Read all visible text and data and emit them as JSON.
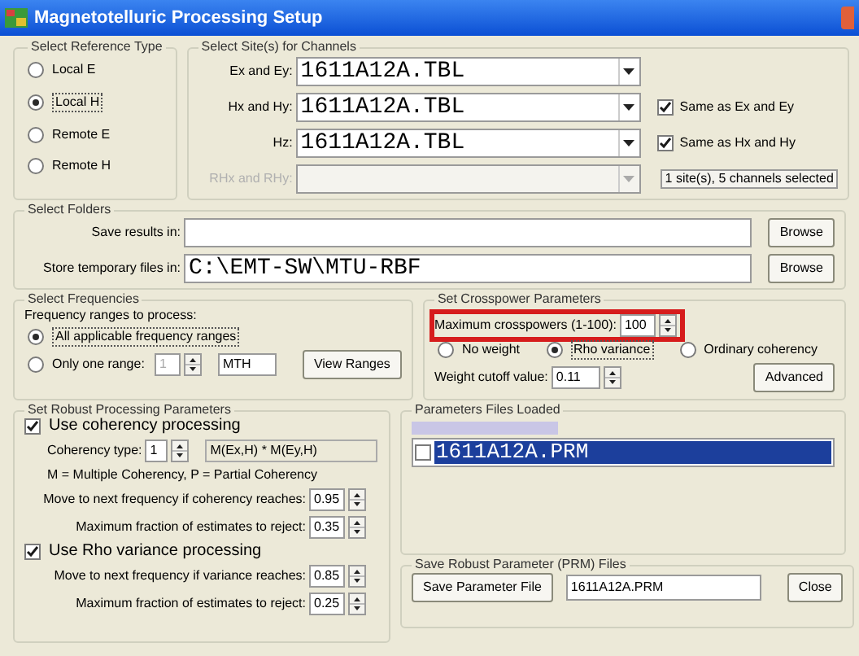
{
  "window": {
    "title": "Magnetotelluric Processing Setup"
  },
  "reference_type": {
    "title": "Select Reference Type",
    "options": [
      {
        "label": "Local E",
        "selected": false
      },
      {
        "label": "Local H",
        "selected": true
      },
      {
        "label": "Remote E",
        "selected": false
      },
      {
        "label": "Remote H",
        "selected": false
      }
    ]
  },
  "sites": {
    "title": "Select Site(s) for Channels",
    "rows": [
      {
        "label": "Ex and Ey:",
        "value": "1611A12A.TBL",
        "disabled": false
      },
      {
        "label": "Hx and Hy:",
        "value": "1611A12A.TBL",
        "disabled": false,
        "checkbox": {
          "label": "Same as Ex and Ey",
          "checked": true
        }
      },
      {
        "label": "Hz:",
        "value": "1611A12A.TBL",
        "disabled": false,
        "checkbox": {
          "label": "Same as Hx and Hy",
          "checked": true
        }
      },
      {
        "label": "RHx and RHy:",
        "disabled": true,
        "status": "1 site(s), 5 channels selected"
      }
    ]
  },
  "folders": {
    "title": "Select Folders",
    "rows": [
      {
        "label": "Save results in:",
        "button": "Browse"
      },
      {
        "label": "Store temporary files in:",
        "value": "C:\\EMT-SW\\MTU-RBF",
        "button": "Browse"
      }
    ]
  },
  "frequencies": {
    "title": "Select Frequencies",
    "prompt": "Frequency ranges to process:",
    "options": [
      {
        "label": "All applicable frequency ranges",
        "selected": true
      },
      {
        "label": "Only one range:",
        "selected": false
      }
    ],
    "range_number": "1",
    "range_name": "MTH",
    "button": "View Ranges"
  },
  "crosspower": {
    "title": "Set Crosspower Parameters",
    "max_label": "Maximum crosspowers (1-100):",
    "max_value": "100",
    "highlighted": true,
    "weights": [
      {
        "label": "No weight",
        "selected": false
      },
      {
        "label": "Rho variance",
        "selected": true
      },
      {
        "label": "Ordinary coherency",
        "selected": false
      }
    ],
    "cutoff_label": "Weight cutoff value:",
    "cutoff_value": "0.11",
    "button": "Advanced"
  },
  "robust": {
    "title": "Set Robust Processing Parameters",
    "coherency": {
      "label": "Use coherency processing",
      "checked": true,
      "type_label": "Coherency type:",
      "type_value": "1",
      "type_formula": "M(Ex,H) * M(Ey,H)",
      "note": "M = Multiple Coherency, P = Partial Coherency",
      "params": [
        {
          "label": "Move to next frequency if coherency reaches:",
          "value": "0.95"
        },
        {
          "label": "Maximum fraction of estimates to reject:",
          "value": "0.35"
        }
      ]
    },
    "rho": {
      "label": "Use Rho variance processing",
      "checked": true,
      "params": [
        {
          "label": "Move to next frequency if variance reaches:",
          "value": "0.85"
        },
        {
          "label": "Maximum fraction of estimates to reject:",
          "value": "0.25"
        }
      ]
    }
  },
  "files_loaded": {
    "title": "Parameters Files Loaded",
    "items": [
      {
        "label": "1611A12A.PRM",
        "checked": false,
        "selected": true
      }
    ]
  },
  "save_prm": {
    "title": "Save Robust Parameter (PRM) Files",
    "button": "Save Parameter File",
    "value": "1611A12A.PRM",
    "close": "Close"
  }
}
